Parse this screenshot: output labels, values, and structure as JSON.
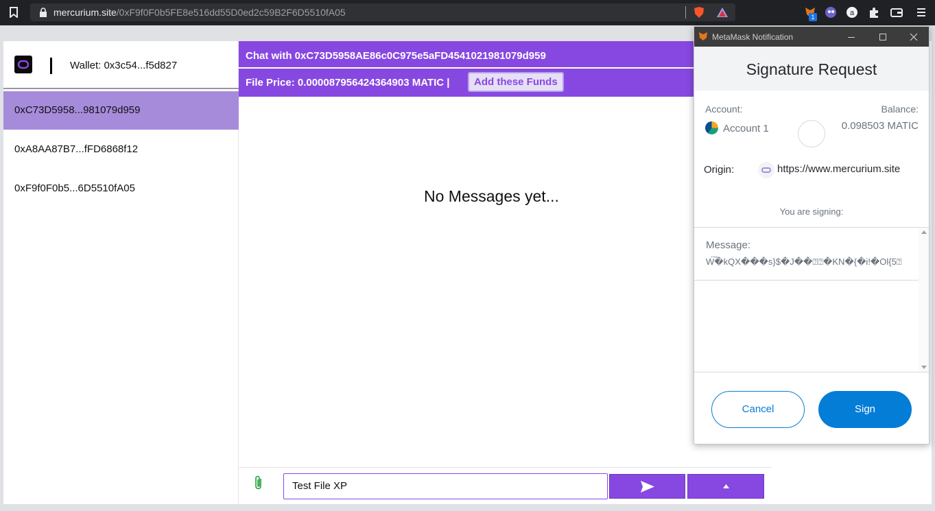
{
  "browser": {
    "url_host": "mercurium.site",
    "url_path": "/0xF9f0F0b5FE8e516dd55D0ed2c59B2F6D5510fA05",
    "extension_badge": "1"
  },
  "sidebar": {
    "wallet_label": "Wallet: 0x3c54...f5d827",
    "contacts": [
      {
        "label": "0xC73D5958...981079d959",
        "active": true
      },
      {
        "label": "0xA8AA87B7...fFD6868f12",
        "active": false
      },
      {
        "label": "0xF9f0F0b5...6D5510fA05",
        "active": false
      }
    ]
  },
  "chat": {
    "title": "Chat with 0xC73D5958AE86c0C975e5aFD4541021981079d959",
    "file_price": "File Price: 0.000087956424364903 MATIC |",
    "add_funds_label": "Add these Funds",
    "empty_text": "No Messages yet...",
    "input_value": "Test File XP"
  },
  "metamask": {
    "window_title": "MetaMask Notification",
    "heading": "Signature Request",
    "account_label": "Account:",
    "balance_label": "Balance:",
    "account_name": "Account 1",
    "balance_value": "0.098503 MATIC",
    "origin_label": "Origin:",
    "origin_value": "https://www.mercurium.site",
    "signing_text": "You are signing:",
    "message_label": "Message:",
    "message_value": "W͠�kQX���s}$�J��⍰⍰�KN�{�i!�Ol{5⍰",
    "cancel_label": "Cancel",
    "sign_label": "Sign"
  },
  "colors": {
    "brand_purple": "#8748e1",
    "active_contact": "#a78bdb",
    "metamask_blue": "#037dd6"
  }
}
